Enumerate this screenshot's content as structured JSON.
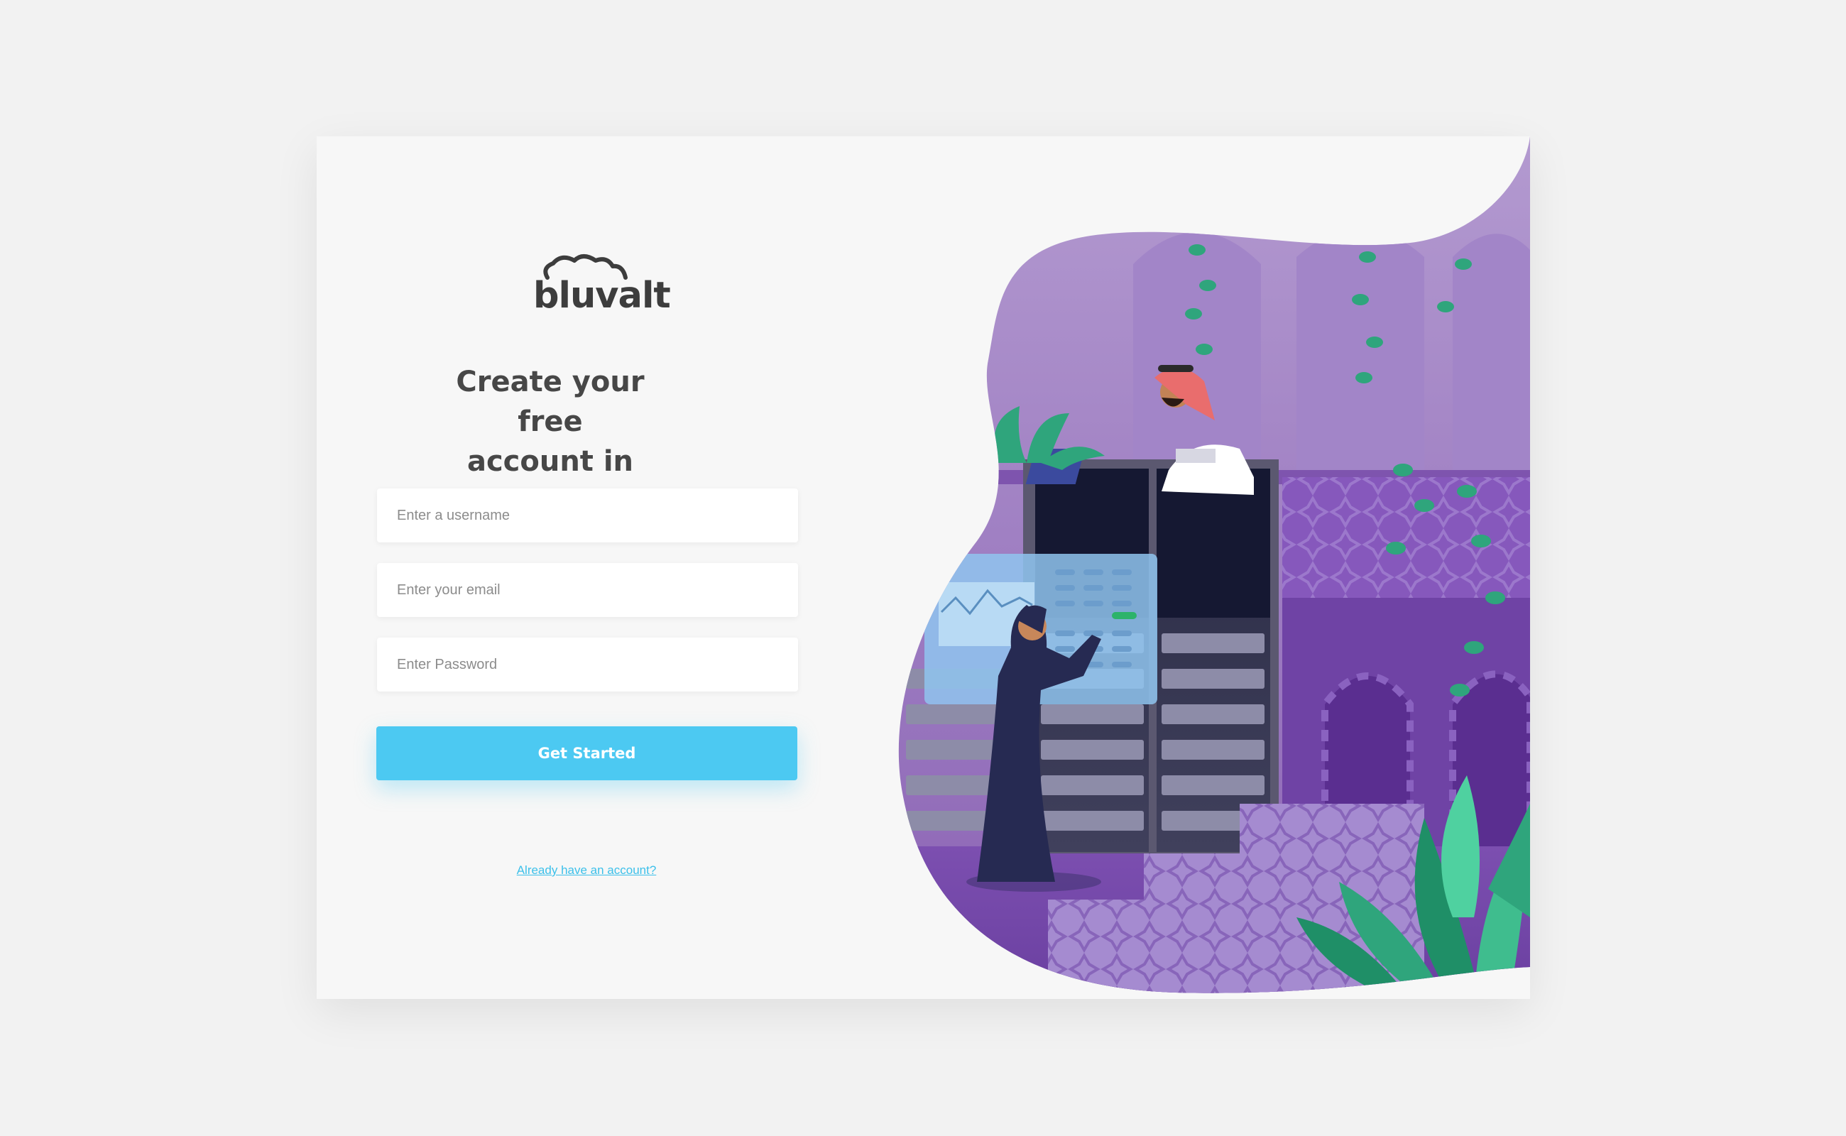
{
  "brand": {
    "name": "bluvalt"
  },
  "signup": {
    "heading_line1": "Create your free",
    "heading_line2": "account in seconds",
    "username_placeholder": "Enter a username",
    "email_placeholder": "Enter your email",
    "password_placeholder": "Enter Password",
    "submit_label": "Get Started",
    "signin_link": "Already have an account?"
  },
  "colors": {
    "page_background": "#f2f2f2",
    "card_background": "#f7f7f7",
    "accent": "#4cc9f2",
    "heading_text": "#474747",
    "illustration_purple": "#8b63b3",
    "illustration_green": "#2fa57c"
  }
}
